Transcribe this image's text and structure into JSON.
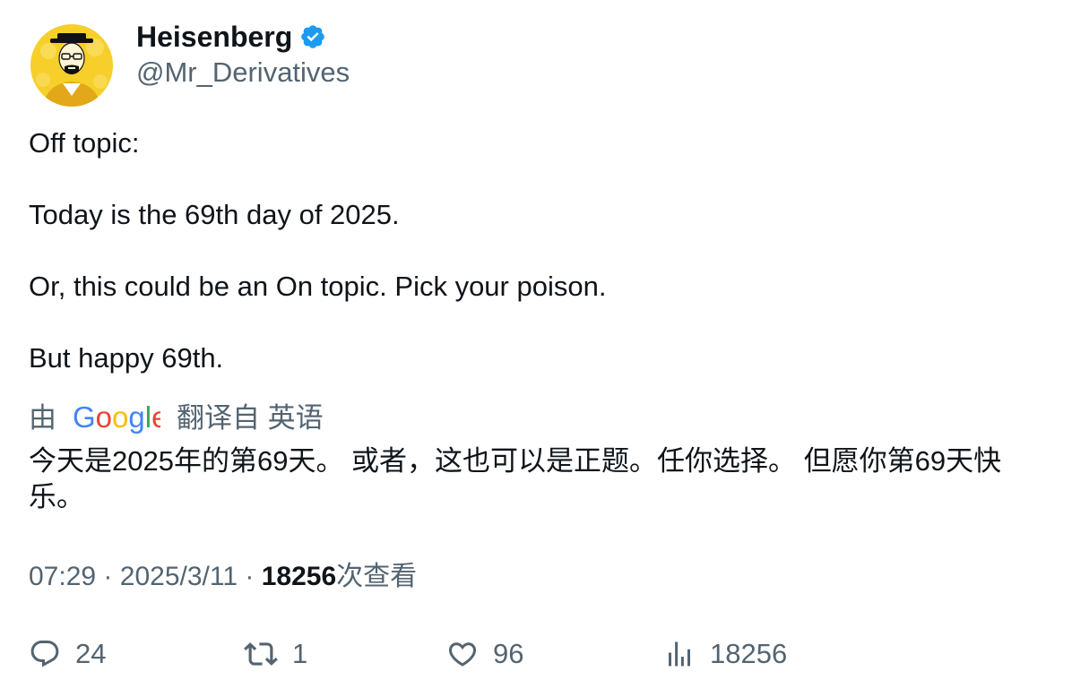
{
  "author": {
    "display_name": "Heisenberg",
    "handle": "@Mr_Derivatives",
    "verified": true,
    "verified_color": "#1d9bf0",
    "avatar_icon": "heisenberg-avatar"
  },
  "tweet": {
    "lines": [
      "Off topic:",
      "Today is the 69th day of 2025.",
      "Or, this could be an On topic. Pick your poison.",
      "But happy 69th."
    ]
  },
  "translation": {
    "prefix": "由",
    "provider": "Google",
    "suffix": "翻译自 英语",
    "text": "今天是2025年的第69天。 或者，这也可以是正题。任你选择。 但愿你第69天快乐。"
  },
  "meta": {
    "time": "07:29",
    "separator": "·",
    "date": "2025/3/11",
    "views_count": "18256",
    "views_label": "次查看"
  },
  "actions": {
    "replies": "24",
    "retweets": "1",
    "likes": "96",
    "views": "18256"
  },
  "colors": {
    "text_primary": "#0f1419",
    "text_secondary": "#536471",
    "avatar_bg": "#f5c518"
  }
}
